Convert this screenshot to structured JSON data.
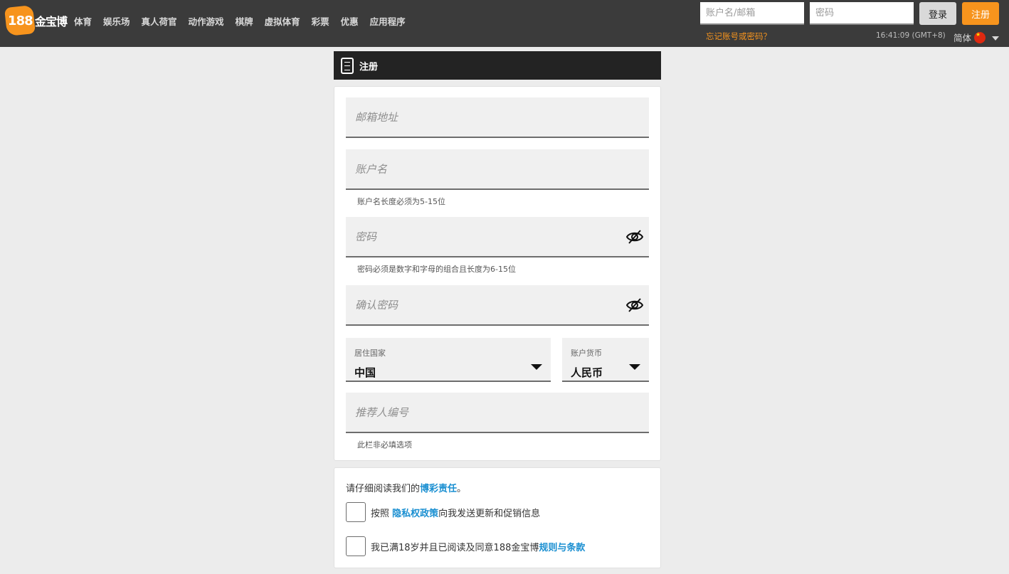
{
  "brand": {
    "number": "188",
    "name": "金宝博"
  },
  "nav": [
    "体育",
    "娱乐场",
    "真人荷官",
    "动作游戏",
    "棋牌",
    "虚拟体育",
    "彩票",
    "优惠",
    "应用程序"
  ],
  "header": {
    "username_placeholder": "账户名/邮箱",
    "password_placeholder": "密码",
    "login_label": "登录",
    "register_label": "注册",
    "forgot_label": "忘记账号或密码？",
    "clock": "16:41:09 (GMT+8)",
    "language": "简体"
  },
  "registration": {
    "title": "注册",
    "email_placeholder": "邮箱地址",
    "username_placeholder": "账户名",
    "username_hint": "账户名长度必须为5-15位",
    "password_placeholder": "密码",
    "password_hint": "密码必须是数字和字母的组合且长度为6-15位",
    "confirm_placeholder": "确认密码",
    "country_label": "居住国家",
    "country_value": "中国",
    "currency_label": "账户货币",
    "currency_value": "人民币",
    "referrer_placeholder": "推荐人编号",
    "referrer_hint": "此栏非必填选项"
  },
  "agreement": {
    "intro_before": "请仔细阅读我们的",
    "intro_link": "博彩责任",
    "intro_after": "。",
    "privacy_before": "按照 ",
    "privacy_link": "隐私权政策",
    "privacy_after": "向我发送更新和促销信息",
    "age_before": "我已满18岁并且已阅读及同意188金宝博",
    "age_link": "规则与条款"
  },
  "colors": {
    "brand_orange": "#f7941d",
    "topbar": "#3b3b3b",
    "link_blue": "#1a8fd1"
  }
}
